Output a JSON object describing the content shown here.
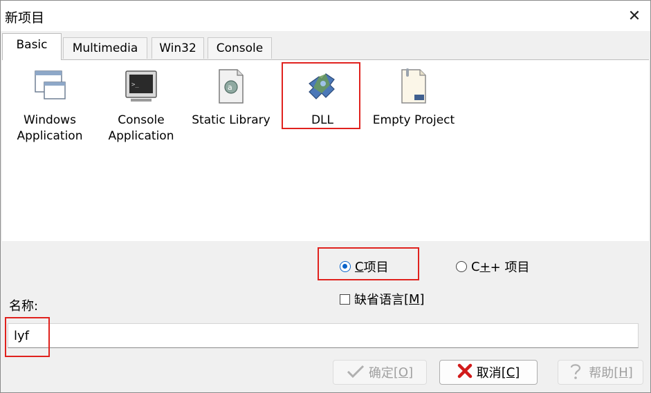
{
  "window": {
    "title": "新项目",
    "close_glyph": "✕"
  },
  "tabs": [
    {
      "label": "Basic",
      "active": true
    },
    {
      "label": "Multimedia",
      "active": false
    },
    {
      "label": "Win32",
      "active": false
    },
    {
      "label": "Console",
      "active": false
    }
  ],
  "templates": [
    {
      "label1": "Windows",
      "label2": "Application",
      "icon": "window-app-icon"
    },
    {
      "label1": "Console",
      "label2": "Application",
      "icon": "console-app-icon"
    },
    {
      "label1": "Static Library",
      "label2": "",
      "icon": "static-library-icon"
    },
    {
      "label1": "DLL",
      "label2": "",
      "icon": "dll-puzzle-icon",
      "selected": true
    },
    {
      "label1": "Empty Project",
      "label2": "",
      "icon": "empty-project-icon"
    }
  ],
  "language": {
    "c_label_prefix": "C",
    "c_label_suffix": " 项目",
    "cpp_label_prefix": "C",
    "cpp_label_underlined": "+",
    "cpp_label_suffix": "+ 项目",
    "c_selected": true,
    "default_lang_label": "缺省语言",
    "default_lang_shortcut": "[M]",
    "default_lang_checked": false
  },
  "name": {
    "label": "名称:",
    "value": "lyf"
  },
  "buttons": {
    "ok_label": "确定",
    "ok_shortcut": "[O]",
    "cancel_label": "取消",
    "cancel_shortcut": "[C]",
    "help_label": "帮助",
    "help_shortcut": "[H]"
  },
  "colors": {
    "highlight_red": "#e0211d",
    "radio_accent": "#0a63c9"
  }
}
